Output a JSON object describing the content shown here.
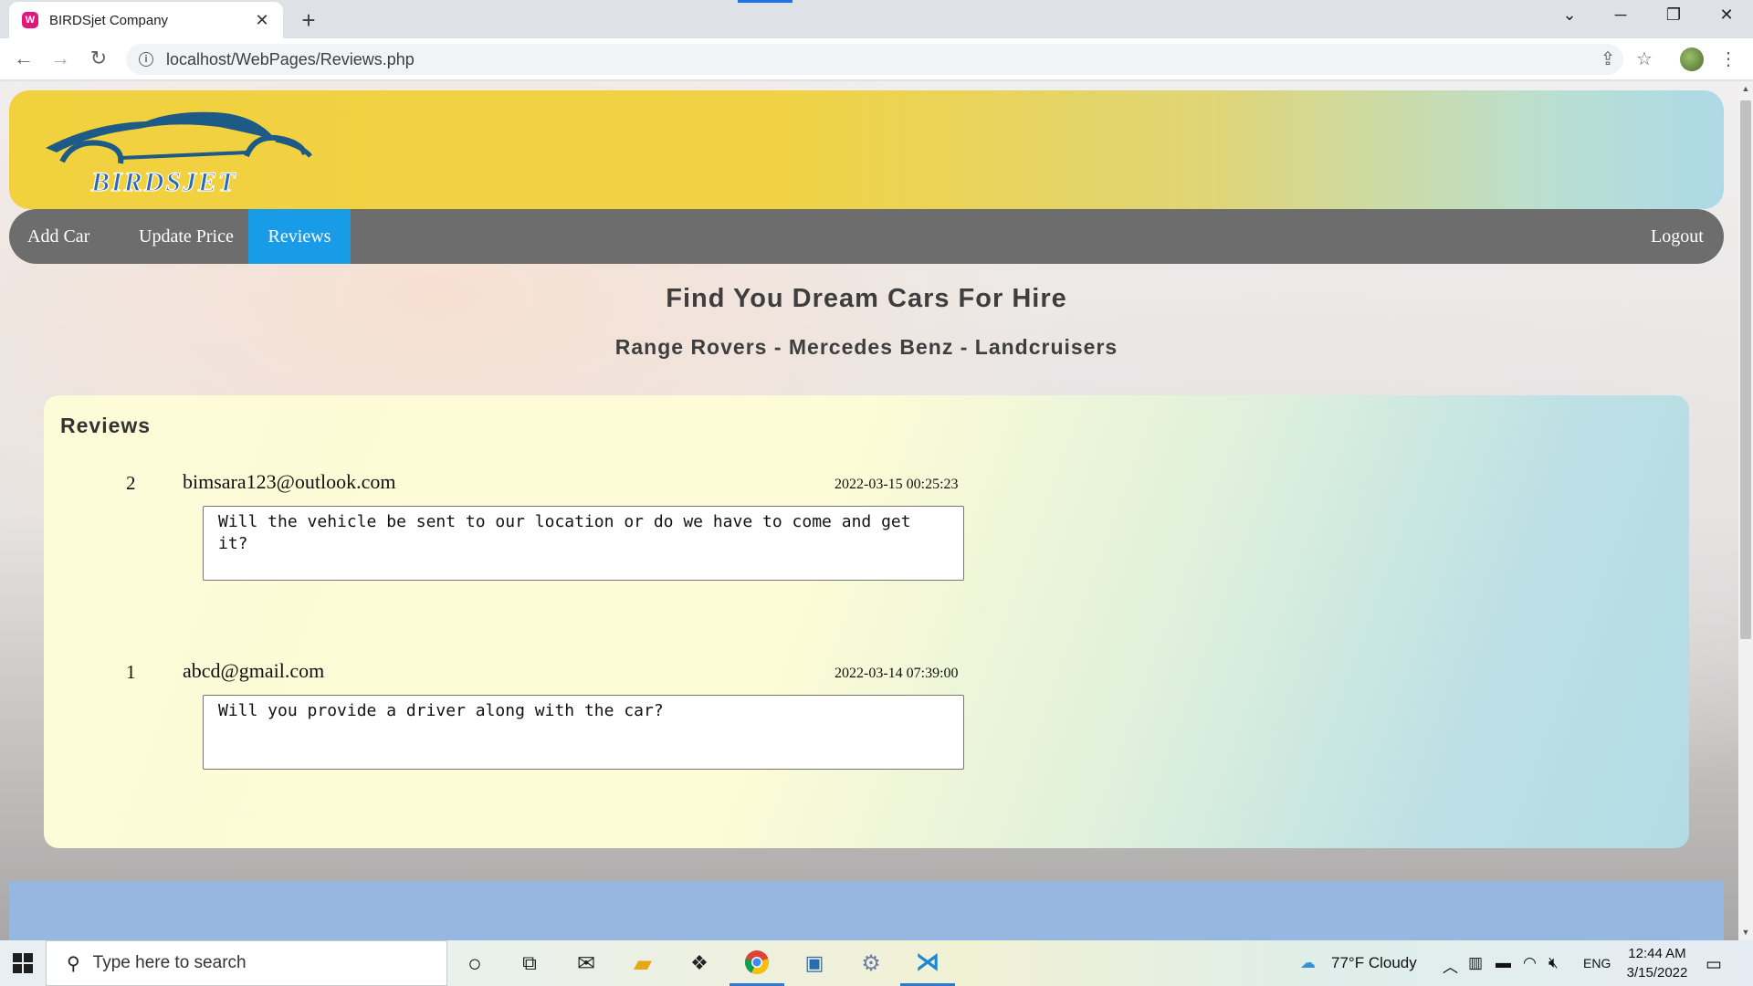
{
  "browser": {
    "tab_title": "BIRDSjet Company",
    "tab_icon": "W",
    "url": "localhost/WebPages/Reviews.php"
  },
  "site": {
    "logo_text": "BIRDSJET",
    "nav": {
      "add_car": "Add Car",
      "update_price": "Update Price",
      "reviews": "Reviews",
      "logout": "Logout",
      "active": "Reviews"
    },
    "hero_title": "Find You Dream Cars For Hire",
    "hero_subtitle": "Range Rovers - Mercedes Benz - Landcruisers",
    "reviews_heading": "Reviews",
    "reviews": [
      {
        "number": "2",
        "email": "bimsara123@outlook.com",
        "datetime": "2022-03-15 00:25:23",
        "text": "Will the vehicle be sent to our location or do we have to come and get it?"
      },
      {
        "number": "1",
        "email": "abcd@gmail.com",
        "datetime": "2022-03-14 07:39:00",
        "text": "Will you provide a driver along with the car?"
      }
    ]
  },
  "taskbar": {
    "search_placeholder": "Type here to search",
    "weather": "77°F  Cloudy",
    "language": "ENG",
    "time": "12:44 AM",
    "date": "3/15/2022"
  },
  "colors": {
    "nav_bg": "#6e6d6e",
    "nav_active": "#199ce8",
    "header_yellow": "#f2d13f",
    "footer_blue": "#96b7df"
  }
}
